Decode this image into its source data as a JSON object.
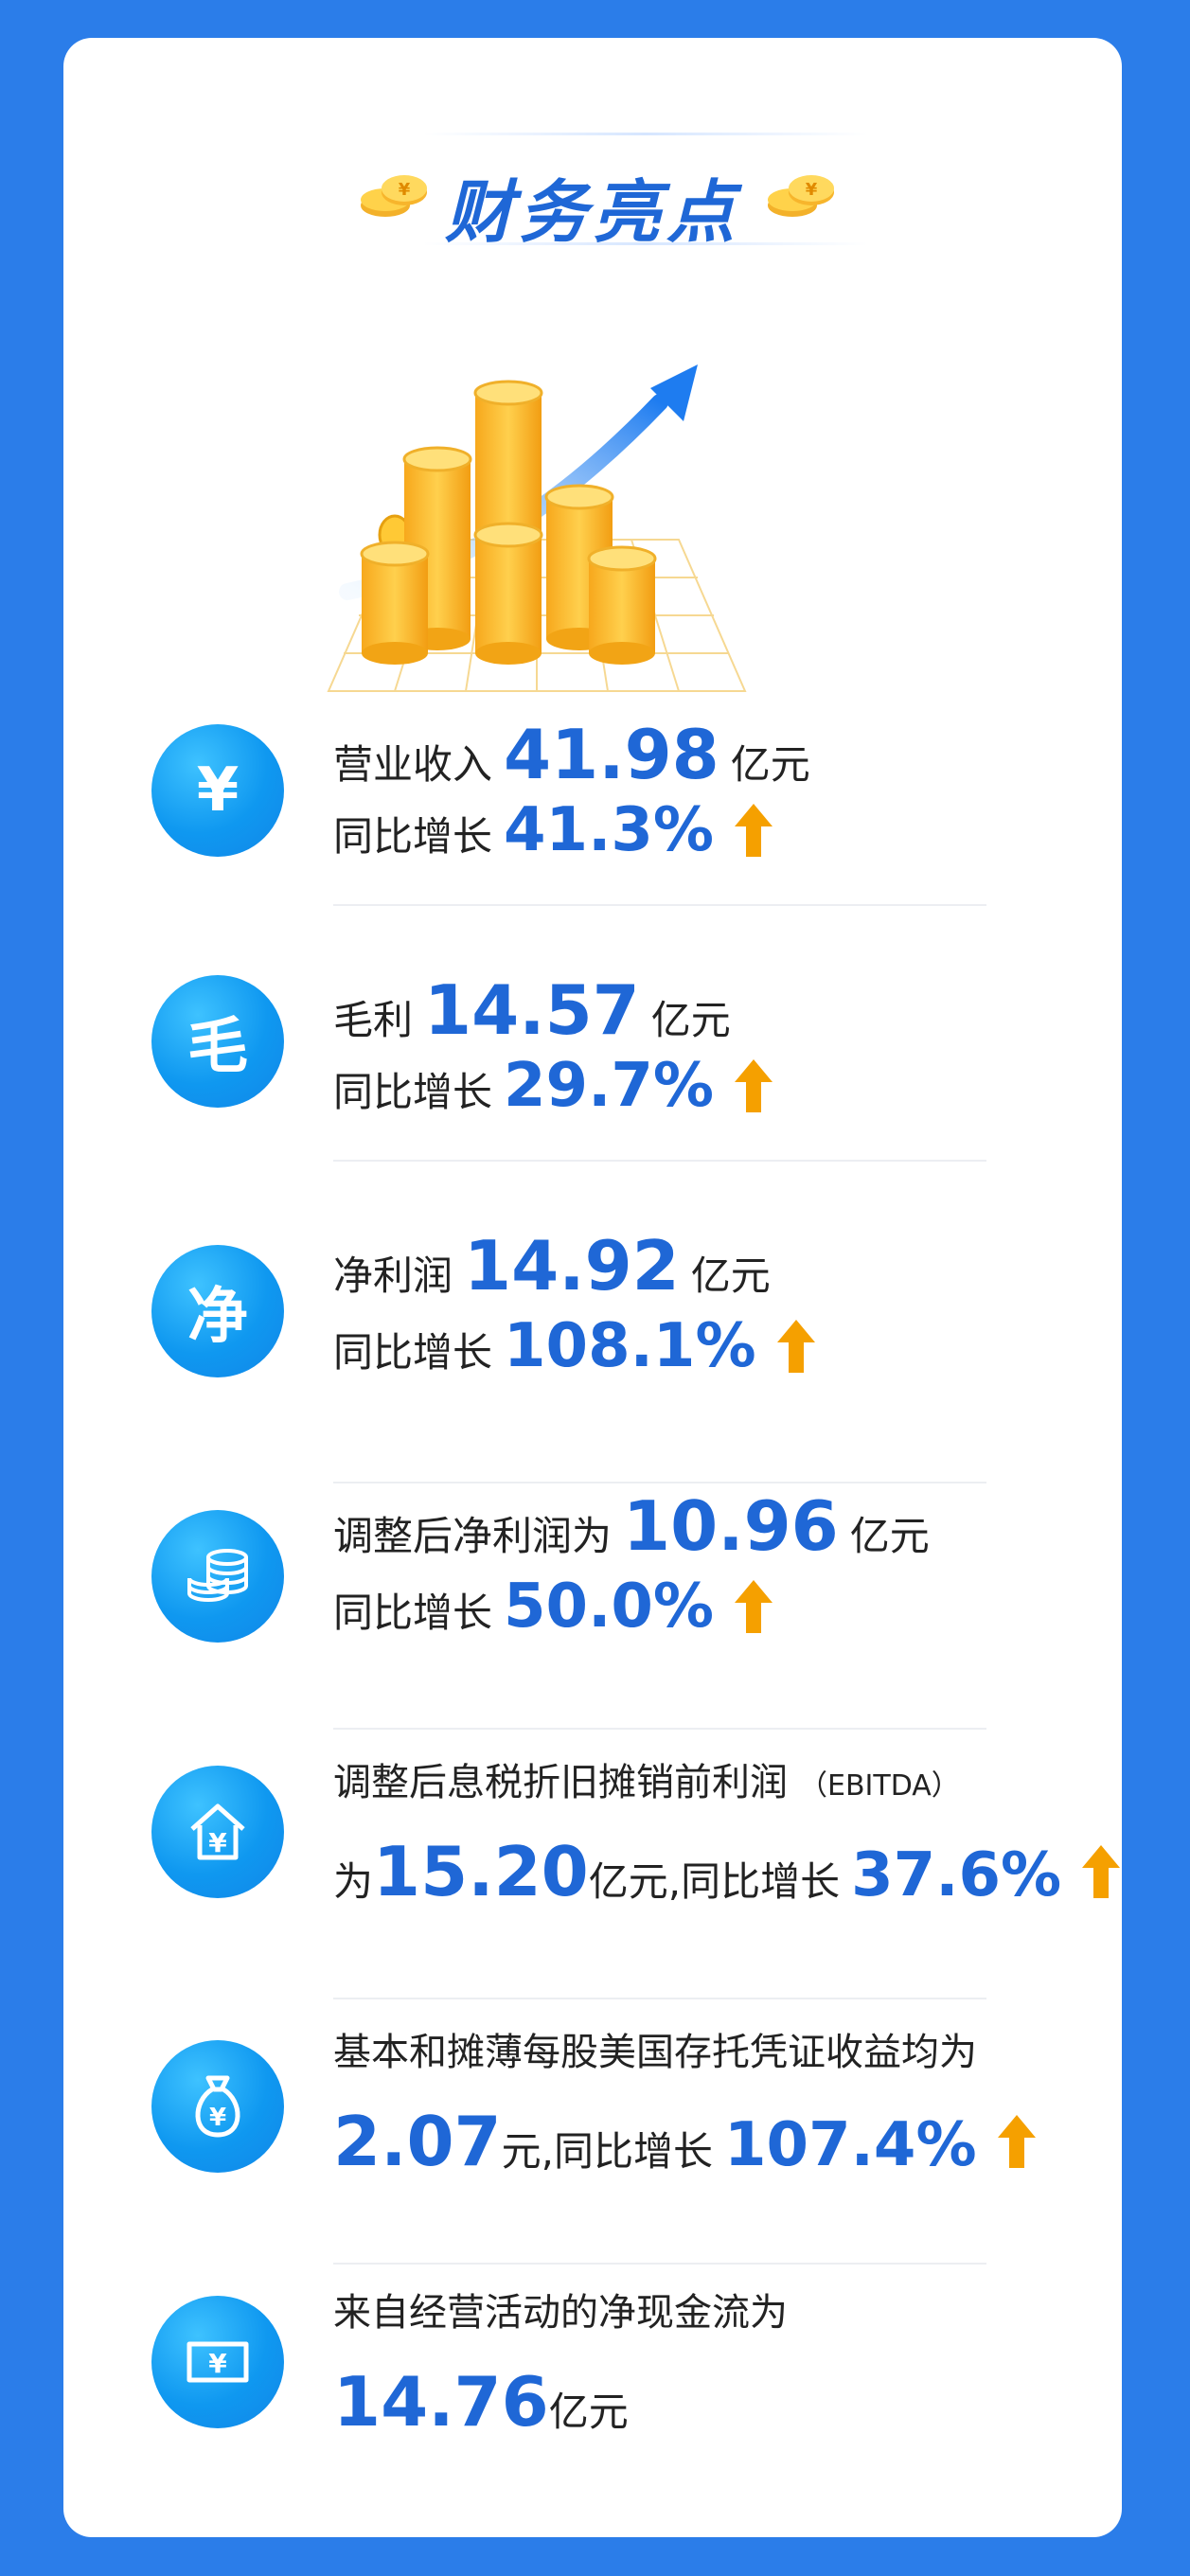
{
  "header": {
    "title": "财务亮点"
  },
  "items": [
    {
      "icon_char": "¥",
      "icon_name": "yen-icon",
      "label": "营业收入",
      "value": "41.98",
      "unit": "亿元",
      "growth_label": "同比增长",
      "growth": "41.3%"
    },
    {
      "icon_char": "毛",
      "icon_name": "gross-icon",
      "label": "毛利",
      "value": "14.57",
      "unit": "亿元",
      "growth_label": "同比增长",
      "growth": "29.7%"
    },
    {
      "icon_char": "净",
      "icon_name": "net-icon",
      "label": "净利润",
      "value": "14.92",
      "unit": "亿元",
      "growth_label": "同比增长",
      "growth": "108.1%"
    },
    {
      "icon_name": "coins-stack-icon",
      "label": "调整后净利润为",
      "value": "10.96",
      "unit": "亿元",
      "growth_label": "同比增长",
      "growth": "50.0%"
    },
    {
      "icon_name": "house-yen-icon",
      "label": "调整后息税折旧摊销前利润",
      "label_suffix": "（EBITDA）",
      "prefix": "为",
      "value": "15.20",
      "unit": "亿元,同比增长",
      "growth": "37.6%"
    },
    {
      "icon_name": "money-bag-icon",
      "label": "基本和摊薄每股美国存托凭证收益均为",
      "value": "2.07",
      "unit": "元,同比增长",
      "growth": "107.4%"
    },
    {
      "icon_name": "banknote-icon",
      "label": "来自经营活动的净现金流为",
      "value": "14.76",
      "unit": "亿元"
    }
  ],
  "colors": {
    "background": "#2b7de9",
    "accent": "#1f67d6",
    "arrow": "#f5a000"
  }
}
